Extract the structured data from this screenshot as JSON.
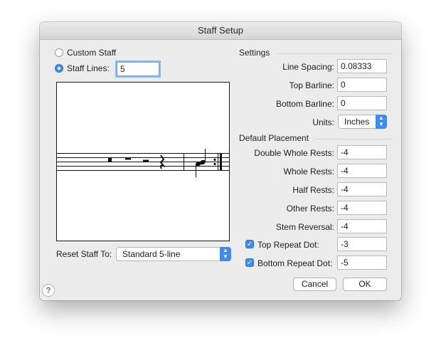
{
  "window": {
    "title": "Staff Setup"
  },
  "staff_type": {
    "custom_label": "Custom Staff",
    "staff_lines_label": "Staff Lines:",
    "staff_lines_value": "5",
    "selected": "Staff Lines"
  },
  "reset": {
    "label": "Reset Staff To:",
    "value": "Standard 5-line"
  },
  "settings": {
    "header": "Settings",
    "line_spacing_label": "Line Spacing:",
    "line_spacing_value": "0.08333",
    "top_barline_label": "Top Barline:",
    "top_barline_value": "0",
    "bottom_barline_label": "Bottom Barline:",
    "bottom_barline_value": "0",
    "units_label": "Units:",
    "units_value": "Inches"
  },
  "placement": {
    "header": "Default Placement",
    "double_whole_label": "Double Whole Rests:",
    "double_whole_value": "-4",
    "whole_label": "Whole Rests:",
    "whole_value": "-4",
    "half_label": "Half Rests:",
    "half_value": "-4",
    "other_label": "Other Rests:",
    "other_value": "-4",
    "stem_label": "Stem Reversal:",
    "stem_value": "-4",
    "top_repeat_label": "Top Repeat Dot:",
    "top_repeat_value": "-3",
    "top_repeat_checked": true,
    "bottom_repeat_label": "Bottom Repeat Dot:",
    "bottom_repeat_value": "-5",
    "bottom_repeat_checked": true
  },
  "buttons": {
    "cancel": "Cancel",
    "ok": "OK",
    "help": "?"
  },
  "icons": {
    "stepper": "up-down-chevron-icon",
    "check": "checkmark-icon",
    "help": "question-mark-icon"
  },
  "colors": {
    "accent": "#3b8df5",
    "window_bg": "#ececec"
  }
}
